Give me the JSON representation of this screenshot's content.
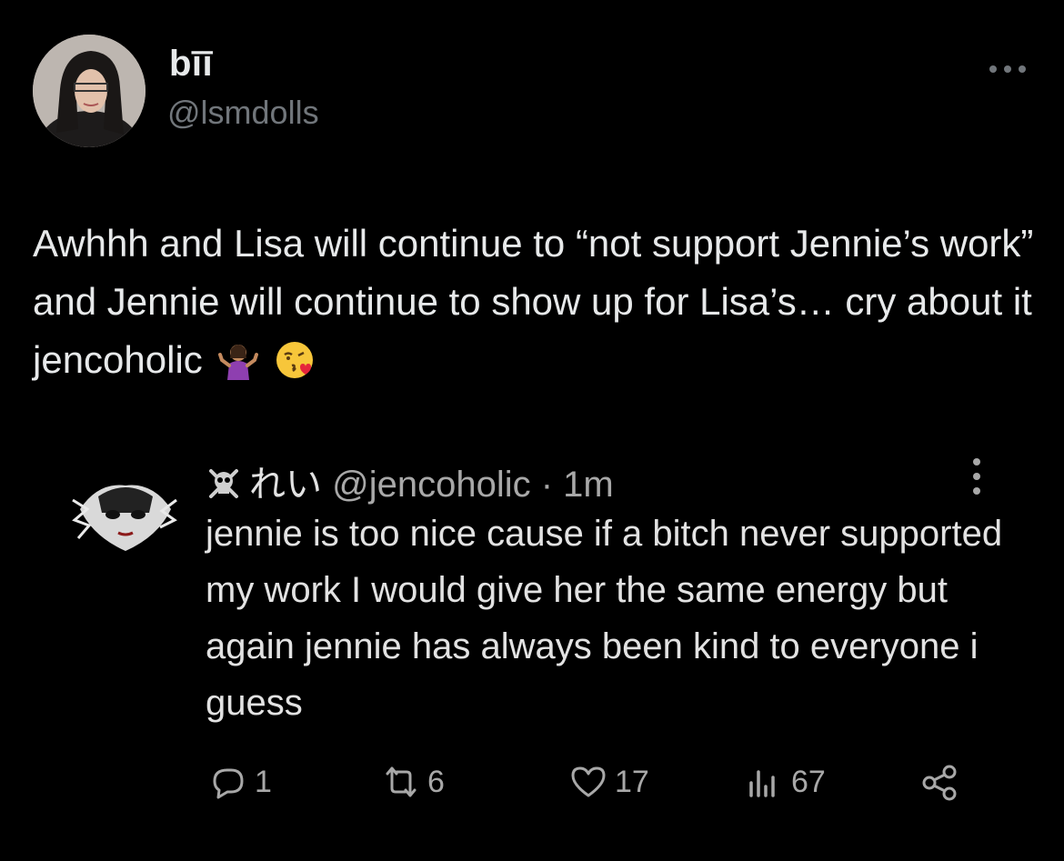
{
  "author": {
    "display_name": "bīī",
    "handle": "@lsmdolls",
    "avatar": "profile-photo"
  },
  "tweet": {
    "text": "Awhhh and Lisa will continue to “not support Jennie’s work” and Jennie will continue to show up for Lisa’s… cry about it jencoholic",
    "emojis": [
      "person-shrugging-emoji",
      "face-blowing-kiss-emoji"
    ]
  },
  "quote": {
    "name": "れい",
    "handle": "@jencoholic",
    "time": "· 1m",
    "text": "jennie is too nice cause if a bitch never supported my work I would give her the same energy but again jennie has always been kind to everyone i guess",
    "actions": {
      "reply_count": "1",
      "retweet_count": "6",
      "like_count": "17",
      "views_count": "67"
    }
  },
  "colors": {
    "background": "#000000",
    "text": "#e7e9ea",
    "secondary": "#71767b"
  }
}
